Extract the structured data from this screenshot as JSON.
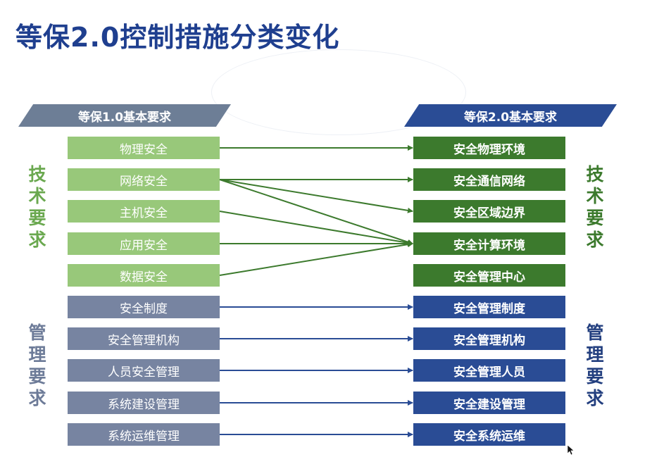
{
  "title": "等保2.0控制措施分类变化",
  "left_header": "等保1.0基本要求",
  "right_header": "等保2.0基本要求",
  "left_items": [
    "物理安全",
    "网络安全",
    "主机安全",
    "应用安全",
    "数据安全",
    "安全制度",
    "安全管理机构",
    "人员安全管理",
    "系统建设管理",
    "系统运维管理"
  ],
  "right_items": [
    "安全物理环境",
    "安全通信网络",
    "安全区域边界",
    "安全计算环境",
    "安全管理中心",
    "安全管理制度",
    "安全管理机构",
    "安全管理人员",
    "安全建设管理",
    "安全系统运维"
  ],
  "side_tech": [
    "技",
    "术",
    "要",
    "求"
  ],
  "side_mgmt": [
    "管",
    "理",
    "要",
    "求"
  ],
  "mappings": [
    [
      0,
      0
    ],
    [
      1,
      1
    ],
    [
      1,
      2
    ],
    [
      1,
      3
    ],
    [
      2,
      3
    ],
    [
      3,
      3
    ],
    [
      4,
      3
    ],
    [
      5,
      5
    ],
    [
      6,
      6
    ],
    [
      7,
      7
    ],
    [
      8,
      8
    ],
    [
      9,
      9
    ]
  ],
  "colors": {
    "tech_line": "#3c7a2d",
    "mgmt_line": "#2a4c95"
  }
}
